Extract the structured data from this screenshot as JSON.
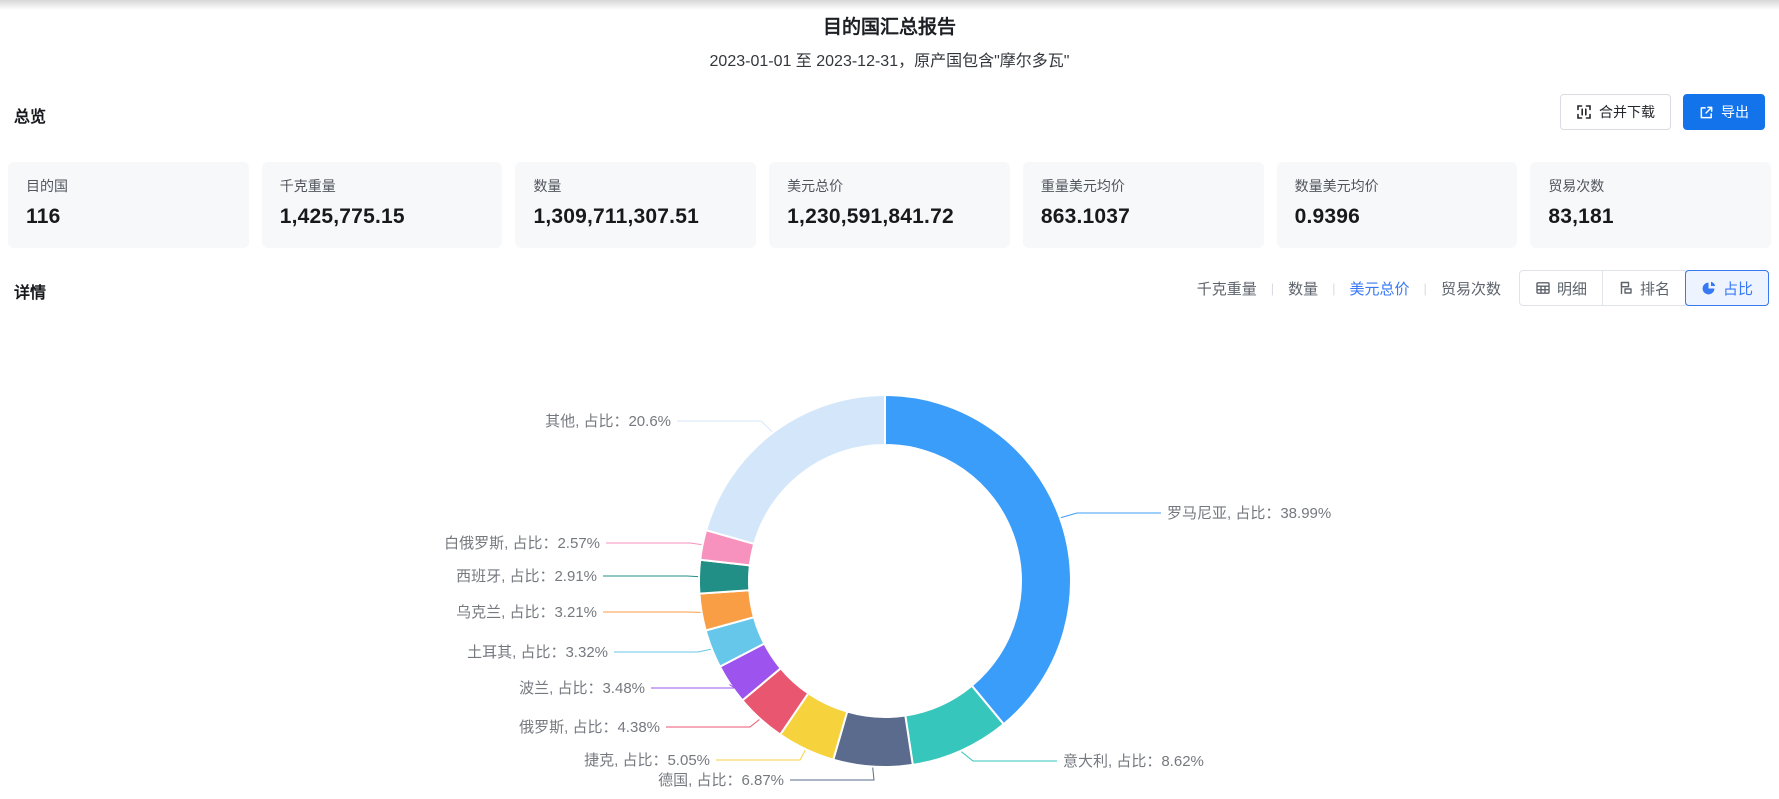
{
  "header": {
    "title": "目的国汇总报告",
    "subtitle": "2023-01-01 至 2023-12-31，原产国包含\"摩尔多瓦\""
  },
  "overview": {
    "section_title": "总览",
    "merge_download_label": "合并下载",
    "export_label": "导出",
    "cards": [
      {
        "label": "目的国",
        "value": "116"
      },
      {
        "label": "千克重量",
        "value": "1,425,775.15"
      },
      {
        "label": "数量",
        "value": "1,309,711,307.51"
      },
      {
        "label": "美元总价",
        "value": "1,230,591,841.72"
      },
      {
        "label": "重量美元均价",
        "value": "863.1037"
      },
      {
        "label": "数量美元均价",
        "value": "0.9396"
      },
      {
        "label": "贸易次数",
        "value": "83,181"
      }
    ]
  },
  "detail": {
    "section_title": "详情",
    "metric_tabs": [
      {
        "label": "千克重量",
        "active": false
      },
      {
        "label": "数量",
        "active": false
      },
      {
        "label": "美元总价",
        "active": true
      },
      {
        "label": "贸易次数",
        "active": false
      }
    ],
    "view_buttons": [
      {
        "label": "明细",
        "icon": "table-icon",
        "active": false
      },
      {
        "label": "排名",
        "icon": "ranking-icon",
        "active": false
      },
      {
        "label": "占比",
        "icon": "pie-icon",
        "active": true
      }
    ]
  },
  "chart_data": {
    "type": "pie",
    "shape": "donut",
    "start_angle_deg": 0,
    "direction": "clockwise",
    "label_prefix": "占比",
    "unit": "%",
    "series": [
      {
        "name": "罗马尼亚",
        "value": 38.99
      },
      {
        "name": "意大利",
        "value": 8.62
      },
      {
        "name": "德国",
        "value": 6.87
      },
      {
        "name": "捷克",
        "value": 5.05
      },
      {
        "name": "俄罗斯",
        "value": 4.38
      },
      {
        "name": "波兰",
        "value": 3.48
      },
      {
        "name": "土耳其",
        "value": 3.32
      },
      {
        "name": "乌克兰",
        "value": 3.21
      },
      {
        "name": "西班牙",
        "value": 2.91
      },
      {
        "name": "白俄罗斯",
        "value": 2.57
      },
      {
        "name": "其他",
        "value": 20.6
      }
    ],
    "palette": [
      "#3B9DFA",
      "#36C6BB",
      "#5A6B8D",
      "#F6D23C",
      "#E95670",
      "#9D53EE",
      "#67C7EB",
      "#FA9E45",
      "#218F85",
      "#F792BE",
      "#D4E7FA"
    ]
  },
  "colors": {
    "accent_blue": "#3778f5",
    "export_button": "#1273eb",
    "card_bg": "#f7f8fa",
    "label_gray": "#75797f"
  }
}
